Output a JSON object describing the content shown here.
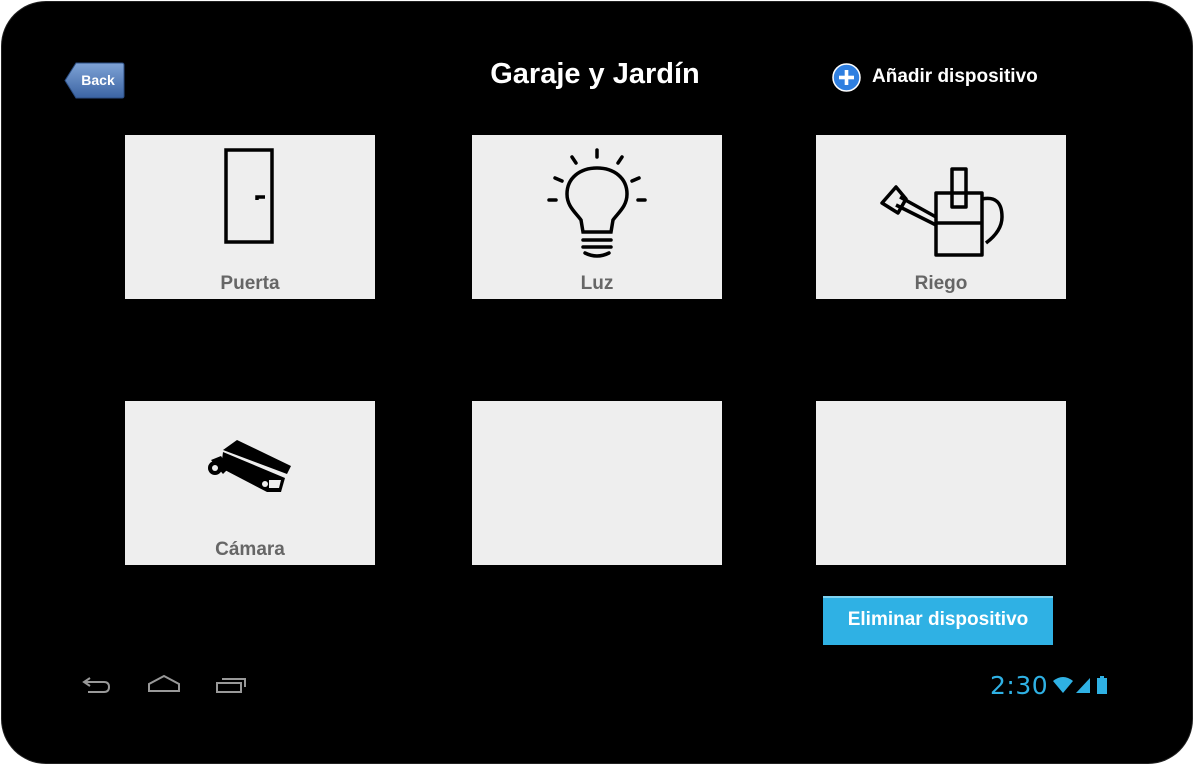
{
  "header": {
    "back_label": "Back",
    "title": "Garaje y Jardín",
    "add_device_label": "Añadir dispositivo"
  },
  "devices": [
    {
      "label": "Puerta",
      "icon": "door-icon"
    },
    {
      "label": "Luz",
      "icon": "lightbulb-icon"
    },
    {
      "label": "Riego",
      "icon": "watering-can-icon"
    },
    {
      "label": "Cámara",
      "icon": "security-camera-icon"
    },
    {
      "label": "",
      "icon": ""
    },
    {
      "label": "",
      "icon": ""
    }
  ],
  "actions": {
    "delete_device_label": "Eliminar dispositivo"
  },
  "status_bar": {
    "time": "2:30",
    "icons": [
      "wifi-icon",
      "signal-icon",
      "battery-icon"
    ]
  },
  "nav_bar": {
    "icons": [
      "back-nav-icon",
      "home-nav-icon",
      "recent-apps-icon"
    ]
  },
  "colors": {
    "accent": "#2fb1e4",
    "tile_bg": "#eeeeee",
    "screen_bg": "#000000",
    "back_button": "#4a78b5"
  }
}
